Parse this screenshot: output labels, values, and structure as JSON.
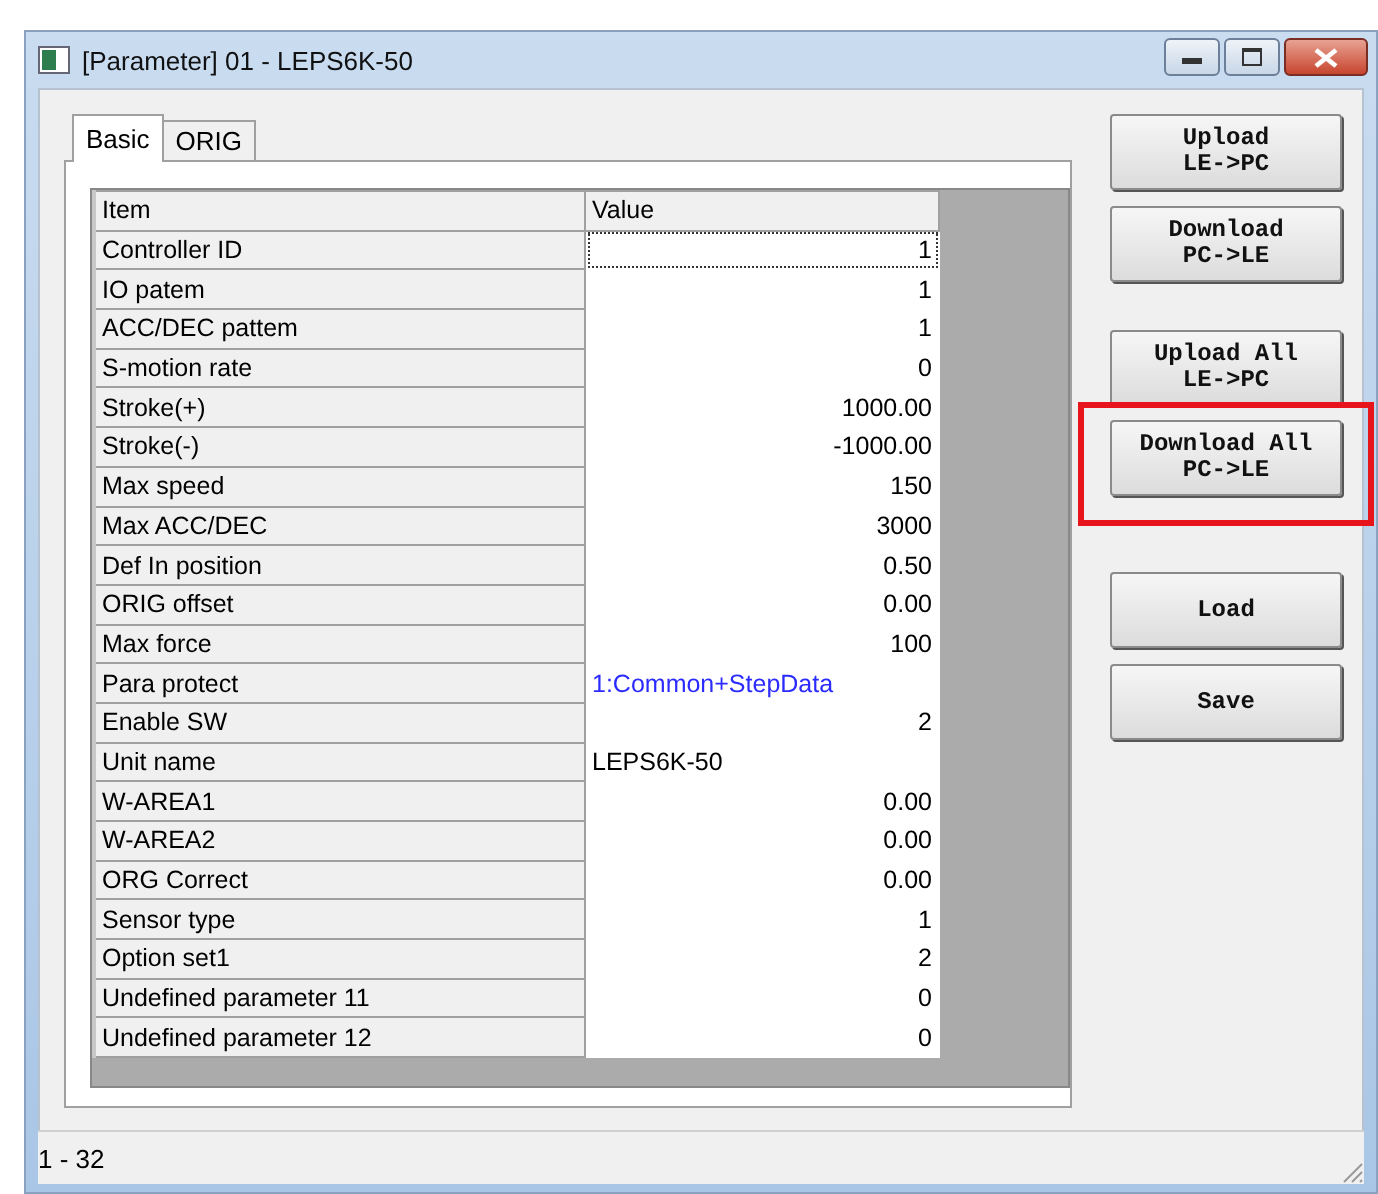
{
  "window": {
    "title": "[Parameter] 01 - LEPS6K-50"
  },
  "tabs": [
    {
      "label": "Basic",
      "selected": true
    },
    {
      "label": "ORIG",
      "selected": false
    }
  ],
  "table": {
    "columns": [
      "Item",
      "Value"
    ],
    "rows": [
      {
        "item": "Controller ID",
        "value": "1",
        "kind": "number",
        "selected": true
      },
      {
        "item": "IO patem",
        "value": "1",
        "kind": "number",
        "selected": false
      },
      {
        "item": "ACC/DEC pattem",
        "value": "1",
        "kind": "number",
        "selected": false
      },
      {
        "item": "S-motion rate",
        "value": "0",
        "kind": "number",
        "selected": false
      },
      {
        "item": "Stroke(+)",
        "value": "1000.00",
        "kind": "number",
        "selected": false
      },
      {
        "item": "Stroke(-)",
        "value": "-1000.00",
        "kind": "number",
        "selected": false
      },
      {
        "item": "Max speed",
        "value": "150",
        "kind": "number",
        "selected": false
      },
      {
        "item": "Max ACC/DEC",
        "value": "3000",
        "kind": "number",
        "selected": false
      },
      {
        "item": "Def In position",
        "value": "0.50",
        "kind": "number",
        "selected": false
      },
      {
        "item": "ORIG offset",
        "value": "0.00",
        "kind": "number",
        "selected": false
      },
      {
        "item": "Max force",
        "value": "100",
        "kind": "number",
        "selected": false
      },
      {
        "item": "Para protect",
        "value": "1:Common+StepData",
        "kind": "option",
        "selected": false
      },
      {
        "item": "Enable SW",
        "value": "2",
        "kind": "number",
        "selected": false
      },
      {
        "item": "Unit name",
        "value": "LEPS6K-50",
        "kind": "text",
        "selected": false
      },
      {
        "item": "W-AREA1",
        "value": "0.00",
        "kind": "number",
        "selected": false
      },
      {
        "item": "W-AREA2",
        "value": "0.00",
        "kind": "number",
        "selected": false
      },
      {
        "item": "ORG Correct",
        "value": "0.00",
        "kind": "number",
        "selected": false
      },
      {
        "item": "Sensor type",
        "value": "1",
        "kind": "number",
        "selected": false
      },
      {
        "item": "Option set1",
        "value": "2",
        "kind": "number",
        "selected": false
      },
      {
        "item": "Undefined parameter 11",
        "value": "0",
        "kind": "number",
        "selected": false
      },
      {
        "item": "Undefined parameter 12",
        "value": "0",
        "kind": "number",
        "selected": false
      }
    ]
  },
  "buttons": [
    {
      "lines": [
        "Upload",
        "LE->PC"
      ],
      "highlighted": false
    },
    {
      "lines": [
        "Download",
        "PC->LE"
      ],
      "highlighted": false
    },
    {
      "lines": [
        "Upload All",
        "LE->PC"
      ],
      "highlighted": false
    },
    {
      "lines": [
        "Download All",
        "PC->LE"
      ],
      "highlighted": true
    },
    {
      "lines": [
        "Load"
      ],
      "highlighted": false
    },
    {
      "lines": [
        "Save"
      ],
      "highlighted": false
    }
  ],
  "status_bar": "1 - 32"
}
